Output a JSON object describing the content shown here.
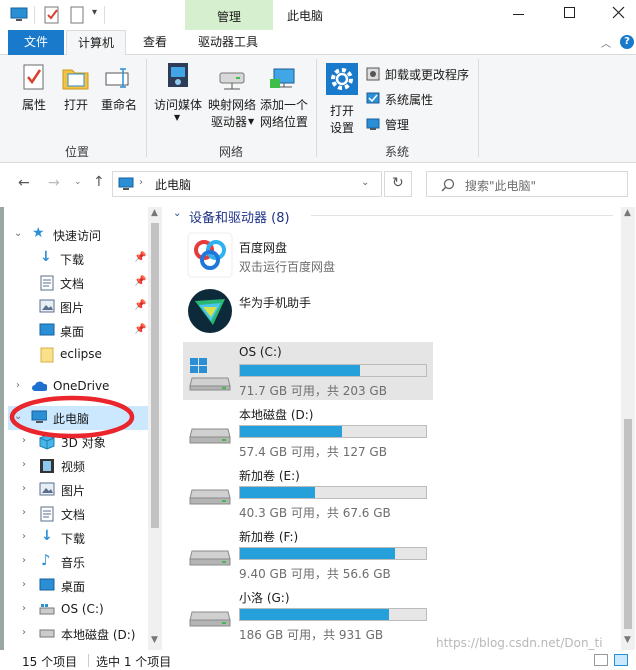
{
  "titlebar": {
    "context_tab": "管理",
    "title": "此电脑",
    "quick_access_icons": [
      "computer-icon",
      "properties-check-icon",
      "new-folder-icon",
      "customize-dropdown-icon"
    ]
  },
  "ribbon_tabs": {
    "file": "文件",
    "computer": "计算机",
    "view": "查看",
    "drive_tools": "驱动器工具"
  },
  "ribbon": {
    "location_group": {
      "label": "位置",
      "properties": "属性",
      "open": "打开",
      "rename": "重命名"
    },
    "network_group": {
      "label": "网络",
      "access_media": "访问媒体",
      "map_drive_1": "映射网络",
      "map_drive_2": "驱动器",
      "add_location_1": "添加一个",
      "add_location_2": "网络位置"
    },
    "system_group": {
      "label": "系统",
      "open_settings_1": "打开",
      "open_settings_2": "设置",
      "uninstall": "卸载或更改程序",
      "system_properties": "系统属性",
      "manage": "管理"
    }
  },
  "address": {
    "path": "此电脑",
    "search_placeholder": "搜索\"此电脑\""
  },
  "nav": {
    "quick_access": "快速访问",
    "downloads": "下载",
    "documents": "文档",
    "pictures": "图片",
    "desktop": "桌面",
    "eclipse": "eclipse",
    "onedrive": "OneDrive",
    "this_pc": "此电脑",
    "objects_3d": "3D 对象",
    "videos": "视频",
    "pc_pictures": "图片",
    "pc_documents": "文档",
    "pc_downloads": "下载",
    "music": "音乐",
    "pc_desktop": "桌面",
    "os_c": "OS (C:)",
    "local_d": "本地磁盘 (D:)"
  },
  "content": {
    "section_title": "设备和驱动器 (8)",
    "apps": [
      {
        "name": "百度网盘",
        "subtitle": "双击运行百度网盘"
      },
      {
        "name": "华为手机助手",
        "subtitle": ""
      }
    ],
    "drives": [
      {
        "name": "OS (C:)",
        "info": "71.7 GB 可用，共 203 GB",
        "used_fraction": 0.647
      },
      {
        "name": "本地磁盘 (D:)",
        "info": "57.4 GB 可用，共 127 GB",
        "used_fraction": 0.548
      },
      {
        "name": "新加卷 (E:)",
        "info": "40.3 GB 可用，共 67.6 GB",
        "used_fraction": 0.404
      },
      {
        "name": "新加卷 (F:)",
        "info": "9.40 GB 可用，共 56.6 GB",
        "used_fraction": 0.834
      },
      {
        "name": "小洛 (G:)",
        "info": "186 GB 可用，共 931 GB",
        "used_fraction": 0.8
      }
    ]
  },
  "status": {
    "item_count": "15 个项目",
    "selected": "选中 1 个项目"
  },
  "watermark": "https://blog.csdn.net/Don_ti",
  "colors": {
    "accent": "#1979ca",
    "context_tab": "#d6f0cf",
    "selection": "#cce8ff",
    "drive_fill": "#26a0da",
    "annotation_red": "#e8262c"
  }
}
